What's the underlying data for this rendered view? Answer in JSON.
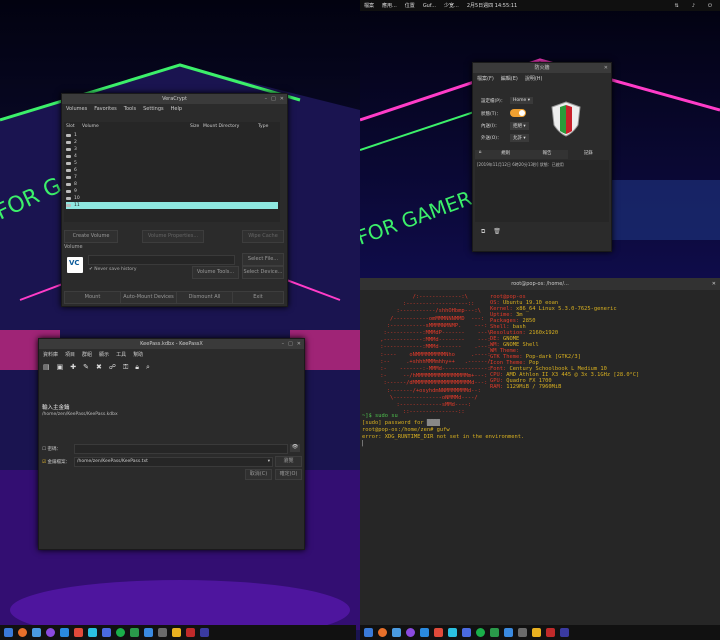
{
  "topbar": {
    "activities": "檔案",
    "apps": "應用...",
    "places": "位置",
    "app_active": "Guf...",
    "input": "少宽...",
    "clock": "2月5日週四 14:55:11"
  },
  "veracrypt": {
    "title": "VeraCrypt",
    "menu": [
      "Volumes",
      "Favorites",
      "Tools",
      "Settings",
      "Help"
    ],
    "columns": [
      "Slot",
      "Volume",
      "Size",
      "Mount Directory",
      "Type"
    ],
    "slots": [
      "1",
      "2",
      "3",
      "4",
      "5",
      "6",
      "7",
      "8",
      "9",
      "10",
      "11"
    ],
    "buttons": {
      "create": "Create Volume",
      "properties": "Volume Properties...",
      "wipe": "Wipe Cache",
      "select_file": "Select File...",
      "volume_tools": "Volume Tools...",
      "select_device": "Select Device...",
      "mount": "Mount",
      "auto_mount": "Auto-Mount Devices",
      "dismount_all": "Dismount All",
      "exit": "Exit"
    },
    "volume_label": "Volume",
    "never_save_history": "Never save history"
  },
  "keepassx": {
    "title": "KeePass.kdbx - KeePassX",
    "menu": [
      "資料庫",
      "項目",
      "群組",
      "顯示",
      "工具",
      "幫助"
    ],
    "heading": "輸入主金鑰",
    "db_path": "/home/zen/KeePass/KeePass.kdbx",
    "password_label": "密碼：",
    "keyfile_label": "金鑰檔案：",
    "keyfile_value": "/home/zen/KeePass/KeePass.txt",
    "browse": "瀏覽",
    "cancel": "取消(C)",
    "ok": "確定(O)"
  },
  "firewall": {
    "title": "防火牆",
    "menu": [
      "檔案(F)",
      "編輯(E)",
      "說明(H)"
    ],
    "profile_label": "設定檔(P)：",
    "profile_value": "Home",
    "status_label": "狀態(T)：",
    "incoming_label": "內送(I)：",
    "incoming_value": "拒絕",
    "outgoing_label": "外送(O)：",
    "outgoing_value": "允許",
    "tabs": [
      "規則",
      "報告",
      "記錄"
    ],
    "log_line": "[2019年11月12日 6時20分13秒] 狀態：已啟用"
  },
  "terminal": {
    "title": "root@pop-os: /home/...",
    "user_host": "root@pop-os",
    "info": [
      [
        "OS: ",
        "Ubuntu 19.10 eoan"
      ],
      [
        "Kernel: ",
        "x86_64 Linux 5.3.0-7625-generic"
      ],
      [
        "Uptime: ",
        "3m"
      ],
      [
        "Packages: ",
        "2850"
      ],
      [
        "Shell: ",
        "bash"
      ],
      [
        "Resolution: ",
        "2160x1920"
      ],
      [
        "DE: ",
        "GNOME"
      ],
      [
        "WM: ",
        "GNOME Shell"
      ],
      [
        "WM Theme: ",
        ""
      ],
      [
        "GTK Theme: ",
        "Pop-dark [GTK2/3]"
      ],
      [
        "Icon Theme: ",
        "Pop"
      ],
      [
        "Font: ",
        "Century Schoolbook L Medium 10"
      ],
      [
        "CPU: ",
        "AMD Athlon II X3 445 @ 3x 3.1GHz [28.0°C]"
      ],
      [
        "GPU: ",
        "Quadro FX 1700"
      ],
      [
        "RAM: ",
        "1129MiB / 7960MiB"
      ]
    ],
    "cmd_prompt": "~]$ sudo su",
    "sudo_line": "[sudo] password for",
    "root_line": "root@pop-os:/home/zen# gufw",
    "error_line": "error: XDG_RUNTIME_DIR not set in the environment."
  },
  "colors": {
    "accent_cyan": "#8ee8e0",
    "term_red": "#e03a2a",
    "term_yellow": "#d8b020",
    "term_green": "#4ec24e",
    "toggle": "#f0a030"
  }
}
